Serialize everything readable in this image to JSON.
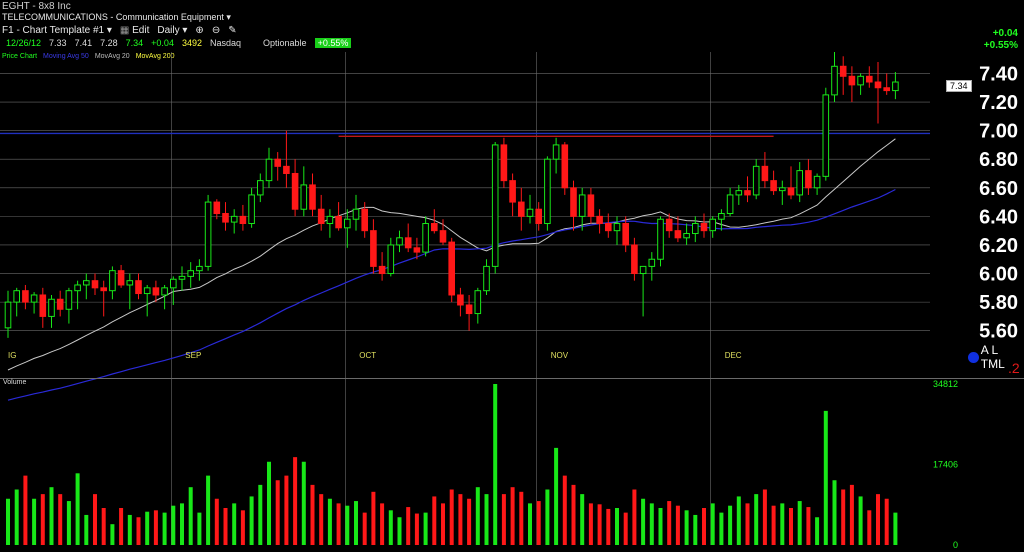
{
  "header": {
    "ticker": "EGHT - 8x8 Inc",
    "sector": "TELECOMMUNICATIONS - Communication Equipment",
    "template": "F1 - Chart Template #1",
    "edit": "Edit",
    "interval": "Daily",
    "quote": {
      "date": "12/26/12",
      "open": "7.33",
      "high": "7.41",
      "low": "7.28",
      "close": "7.34",
      "change": "+0.04",
      "volume": "3492",
      "exchange": "Nasdaq",
      "optionable": "Optionable",
      "pct": "+0.55%"
    },
    "legend": {
      "price": "Price Chart",
      "ma20": "Moving Avg 50",
      "ma50": "MovAvg 20",
      "ma200": "MovAvg 200"
    },
    "change_right": "+0.04",
    "pct_right": "+0.55%",
    "last_price_label": "7.34",
    "bottom_right_text": "A L TML",
    "bottom_right_num": ".2"
  },
  "colors": {
    "up": "#18e818",
    "down": "#ff1818",
    "ma_short": "#c8c8c8",
    "ma_long": "#2a2ad8",
    "resistance_blue": "#2030c0",
    "resistance_red": "#c01818",
    "grid": "#6a6a6a",
    "axis_text": "#ffffff",
    "month_text": "#e0e060"
  },
  "chart_data": {
    "type": "candlestick",
    "price_axis": {
      "ylim": [
        5.5,
        7.55
      ],
      "ticks": [
        "5.60",
        "5.80",
        "6.00",
        "6.20",
        "6.40",
        "6.60",
        "6.80",
        "7.00",
        "7.20",
        "7.40"
      ]
    },
    "volume_axis": {
      "ylim": [
        0,
        34812
      ],
      "ticks": [
        "0",
        "17406",
        "34812"
      ],
      "label": "Volume"
    },
    "month_labels": [
      {
        "label": "IG",
        "index": 0
      },
      {
        "label": "SEP",
        "index": 19
      },
      {
        "label": "OCT",
        "index": 39
      },
      {
        "label": "NOV",
        "index": 61
      },
      {
        "label": "DEC",
        "index": 81
      }
    ],
    "horizontal_lines": [
      {
        "price": 6.98,
        "color": "blue"
      },
      {
        "price": 6.96,
        "color": "red"
      }
    ],
    "candles": [
      [
        5.62,
        5.88,
        5.55,
        5.8,
        10000
      ],
      [
        5.8,
        5.9,
        5.7,
        5.88,
        12000
      ],
      [
        5.88,
        5.92,
        5.75,
        5.8,
        15000
      ],
      [
        5.8,
        5.87,
        5.72,
        5.85,
        10000
      ],
      [
        5.85,
        5.9,
        5.62,
        5.7,
        11000
      ],
      [
        5.7,
        5.85,
        5.62,
        5.82,
        12500
      ],
      [
        5.82,
        5.88,
        5.7,
        5.75,
        11000
      ],
      [
        5.75,
        5.9,
        5.65,
        5.88,
        9500
      ],
      [
        5.88,
        5.95,
        5.75,
        5.92,
        15500
      ],
      [
        5.92,
        6.0,
        5.82,
        5.95,
        6500
      ],
      [
        5.95,
        6.0,
        5.85,
        5.9,
        11000
      ],
      [
        5.9,
        5.95,
        5.7,
        5.88,
        8000
      ],
      [
        5.88,
        6.05,
        5.82,
        6.02,
        4500
      ],
      [
        6.02,
        6.06,
        5.9,
        5.92,
        8000
      ],
      [
        5.92,
        6.0,
        5.75,
        5.95,
        6500
      ],
      [
        5.95,
        6.0,
        5.82,
        5.86,
        6000
      ],
      [
        5.86,
        5.92,
        5.7,
        5.9,
        7200
      ],
      [
        5.9,
        5.95,
        5.8,
        5.85,
        7500
      ],
      [
        5.85,
        5.92,
        5.75,
        5.9,
        7000
      ],
      [
        5.9,
        5.98,
        5.78,
        5.96,
        8500
      ],
      [
        5.96,
        6.05,
        5.88,
        5.98,
        9000
      ],
      [
        5.98,
        6.08,
        5.9,
        6.02,
        12500
      ],
      [
        6.02,
        6.1,
        5.95,
        6.05,
        7000
      ],
      [
        6.05,
        6.55,
        6.02,
        6.5,
        15000
      ],
      [
        6.5,
        6.52,
        6.38,
        6.42,
        10000
      ],
      [
        6.42,
        6.5,
        6.3,
        6.36,
        8000
      ],
      [
        6.36,
        6.45,
        6.28,
        6.4,
        9000
      ],
      [
        6.4,
        6.48,
        6.3,
        6.35,
        7500
      ],
      [
        6.35,
        6.6,
        6.32,
        6.55,
        10500
      ],
      [
        6.55,
        6.7,
        6.5,
        6.65,
        13000
      ],
      [
        6.65,
        6.88,
        6.6,
        6.8,
        18000
      ],
      [
        6.8,
        6.85,
        6.65,
        6.75,
        14000
      ],
      [
        6.75,
        7.0,
        6.6,
        6.7,
        15000
      ],
      [
        6.7,
        6.8,
        6.4,
        6.45,
        19000
      ],
      [
        6.45,
        6.75,
        6.4,
        6.62,
        18000
      ],
      [
        6.62,
        6.7,
        6.4,
        6.45,
        13000
      ],
      [
        6.45,
        6.55,
        6.3,
        6.35,
        11000
      ],
      [
        6.35,
        6.45,
        6.25,
        6.4,
        10000
      ],
      [
        6.4,
        6.5,
        6.3,
        6.32,
        9000
      ],
      [
        6.32,
        6.45,
        6.18,
        6.38,
        8500
      ],
      [
        6.38,
        6.55,
        6.3,
        6.45,
        9500
      ],
      [
        6.45,
        6.5,
        6.25,
        6.3,
        7000
      ],
      [
        6.3,
        6.38,
        6.0,
        6.05,
        11500
      ],
      [
        6.05,
        6.15,
        5.95,
        6.0,
        9000
      ],
      [
        6.0,
        6.25,
        5.98,
        6.2,
        7500
      ],
      [
        6.2,
        6.3,
        6.15,
        6.25,
        6000
      ],
      [
        6.25,
        6.35,
        6.15,
        6.18,
        8200
      ],
      [
        6.18,
        6.25,
        6.1,
        6.15,
        6800
      ],
      [
        6.15,
        6.4,
        6.12,
        6.35,
        7000
      ],
      [
        6.35,
        6.45,
        6.28,
        6.3,
        10500
      ],
      [
        6.3,
        6.38,
        6.2,
        6.22,
        9000
      ],
      [
        6.22,
        6.25,
        5.8,
        5.85,
        12000
      ],
      [
        5.85,
        5.9,
        5.7,
        5.78,
        11000
      ],
      [
        5.78,
        5.85,
        5.6,
        5.72,
        10000
      ],
      [
        5.72,
        5.9,
        5.65,
        5.88,
        12500
      ],
      [
        5.88,
        6.1,
        5.85,
        6.05,
        11000
      ],
      [
        6.05,
        6.92,
        6.0,
        6.9,
        34812
      ],
      [
        6.9,
        6.95,
        6.6,
        6.65,
        11000
      ],
      [
        6.65,
        6.7,
        6.4,
        6.5,
        12500
      ],
      [
        6.5,
        6.6,
        6.3,
        6.4,
        11500
      ],
      [
        6.4,
        6.55,
        6.35,
        6.45,
        9000
      ],
      [
        6.45,
        6.5,
        6.3,
        6.35,
        9500
      ],
      [
        6.35,
        6.82,
        6.3,
        6.8,
        12000
      ],
      [
        6.8,
        6.95,
        6.7,
        6.9,
        21000
      ],
      [
        6.9,
        6.92,
        6.55,
        6.6,
        15000
      ],
      [
        6.6,
        6.65,
        6.3,
        6.4,
        13000
      ],
      [
        6.4,
        6.6,
        6.3,
        6.55,
        11000
      ],
      [
        6.55,
        6.6,
        6.35,
        6.4,
        9000
      ],
      [
        6.4,
        6.45,
        6.28,
        6.35,
        8800
      ],
      [
        6.35,
        6.42,
        6.25,
        6.3,
        7800
      ],
      [
        6.3,
        6.4,
        6.2,
        6.35,
        8000
      ],
      [
        6.35,
        6.4,
        6.15,
        6.2,
        7000
      ],
      [
        6.2,
        6.25,
        5.95,
        6.0,
        12000
      ],
      [
        6.0,
        6.05,
        5.7,
        6.05,
        10000
      ],
      [
        6.05,
        6.15,
        5.95,
        6.1,
        9000
      ],
      [
        6.1,
        6.4,
        6.05,
        6.38,
        8000
      ],
      [
        6.38,
        6.42,
        6.25,
        6.3,
        9500
      ],
      [
        6.3,
        6.4,
        6.22,
        6.25,
        8500
      ],
      [
        6.25,
        6.35,
        6.2,
        6.28,
        7500
      ],
      [
        6.28,
        6.4,
        6.22,
        6.35,
        6500
      ],
      [
        6.35,
        6.42,
        6.25,
        6.3,
        8000
      ],
      [
        6.3,
        6.4,
        6.25,
        6.38,
        9000
      ],
      [
        6.38,
        6.45,
        6.3,
        6.42,
        7000
      ],
      [
        6.42,
        6.6,
        6.4,
        6.55,
        8500
      ],
      [
        6.55,
        6.62,
        6.48,
        6.58,
        10500
      ],
      [
        6.58,
        6.68,
        6.5,
        6.55,
        9000
      ],
      [
        6.55,
        6.8,
        6.52,
        6.75,
        11000
      ],
      [
        6.75,
        6.85,
        6.6,
        6.65,
        12000
      ],
      [
        6.65,
        6.72,
        6.55,
        6.58,
        8500
      ],
      [
        6.58,
        6.65,
        6.48,
        6.6,
        9000
      ],
      [
        6.6,
        6.75,
        6.52,
        6.55,
        8000
      ],
      [
        6.55,
        6.78,
        6.5,
        6.72,
        9500
      ],
      [
        6.72,
        6.8,
        6.55,
        6.6,
        8200
      ],
      [
        6.6,
        6.7,
        6.55,
        6.68,
        6000
      ],
      [
        6.68,
        7.3,
        6.65,
        7.25,
        29000
      ],
      [
        7.25,
        7.55,
        7.2,
        7.45,
        14000
      ],
      [
        7.45,
        7.52,
        7.25,
        7.38,
        12000
      ],
      [
        7.38,
        7.45,
        7.2,
        7.32,
        13000
      ],
      [
        7.32,
        7.4,
        7.25,
        7.38,
        10500
      ],
      [
        7.38,
        7.45,
        7.3,
        7.34,
        7500
      ],
      [
        7.34,
        7.48,
        7.05,
        7.3,
        11000
      ],
      [
        7.3,
        7.4,
        7.25,
        7.28,
        10000
      ],
      [
        7.28,
        7.41,
        7.22,
        7.34,
        7000
      ]
    ]
  }
}
